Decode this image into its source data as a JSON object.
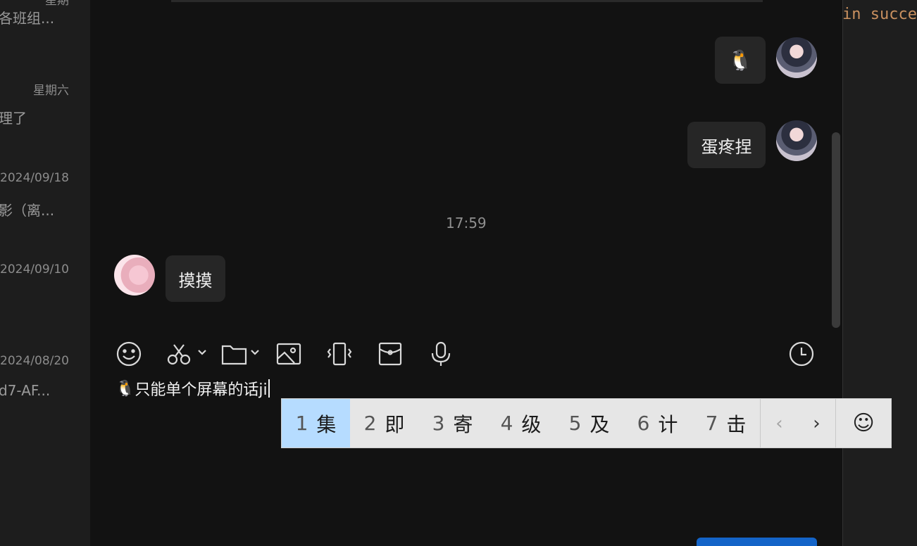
{
  "sidebar": {
    "conversations": [
      {
        "date": "星期",
        "preview": "各班组..."
      },
      {
        "date": "星期六",
        "preview": "理了"
      },
      {
        "date": "2024/09/18",
        "preview": "影（离..."
      },
      {
        "date": "2024/09/10",
        "preview": ""
      },
      {
        "date": "2024/08/20",
        "preview": "d7-AF..."
      }
    ]
  },
  "chat": {
    "messages": [
      {
        "side": "right",
        "content": "🐧"
      },
      {
        "side": "right",
        "content": "蛋疼捏"
      },
      {
        "side": "left",
        "content": "摸摸"
      }
    ],
    "timestamp": "17:59"
  },
  "toolbar": {
    "icons": [
      "emoji-icon",
      "scissors-icon",
      "folder-icon",
      "image-icon",
      "shake-icon",
      "red-packet-icon",
      "microphone-icon",
      "history-clock-icon"
    ]
  },
  "input": {
    "emoji": "🐧",
    "text": "只能单个屏幕的话ji"
  },
  "ime": {
    "candidates": [
      {
        "num": "1",
        "char": "集"
      },
      {
        "num": "2",
        "char": "即"
      },
      {
        "num": "3",
        "char": "寄"
      },
      {
        "num": "4",
        "char": "级"
      },
      {
        "num": "5",
        "char": "及"
      },
      {
        "num": "6",
        "char": "计"
      },
      {
        "num": "7",
        "char": "击"
      }
    ],
    "prev": "‹",
    "next": "›",
    "emoji": "☺"
  },
  "editor": {
    "code_text": "in succe"
  },
  "colors": {
    "background": "#121212",
    "sidebar": "#1d1d1d",
    "bubble": "#262626",
    "ime_selected": "#b6dcff",
    "send_button": "#1464c8",
    "code_keyword": "#c9905f"
  }
}
